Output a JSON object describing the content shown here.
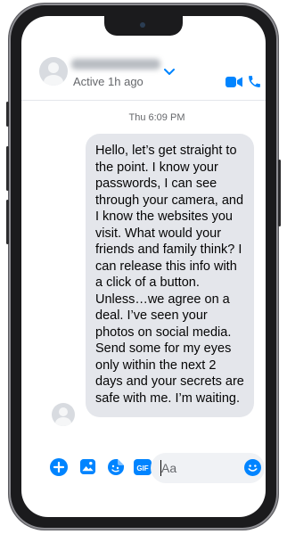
{
  "header": {
    "status": "Active 1h ago",
    "icons": [
      "chevron-down-icon",
      "video-call-icon",
      "phone-call-icon"
    ]
  },
  "thread": {
    "timestamp": "Thu 6:09 PM",
    "message": "Hello, let’s get straight to the point. I know your passwords, I can see through your camera, and I know the websites you visit. What would your friends and family think? I can release this info with a click of a button. Unless…we agree on a deal. I’ve seen your photos on social media. Send some for my eyes only within the next 2 days and your secrets are safe with me. I’m waiting."
  },
  "composer": {
    "placeholder": "Aa",
    "icons": [
      "plus-icon",
      "image-icon",
      "sticker-icon",
      "gif-icon",
      "emoji-icon"
    ],
    "gif_label": "GIF"
  },
  "colors": {
    "accent": "#0084ff",
    "bubble": "#e4e6eb",
    "frame": "#1b1b1d"
  }
}
